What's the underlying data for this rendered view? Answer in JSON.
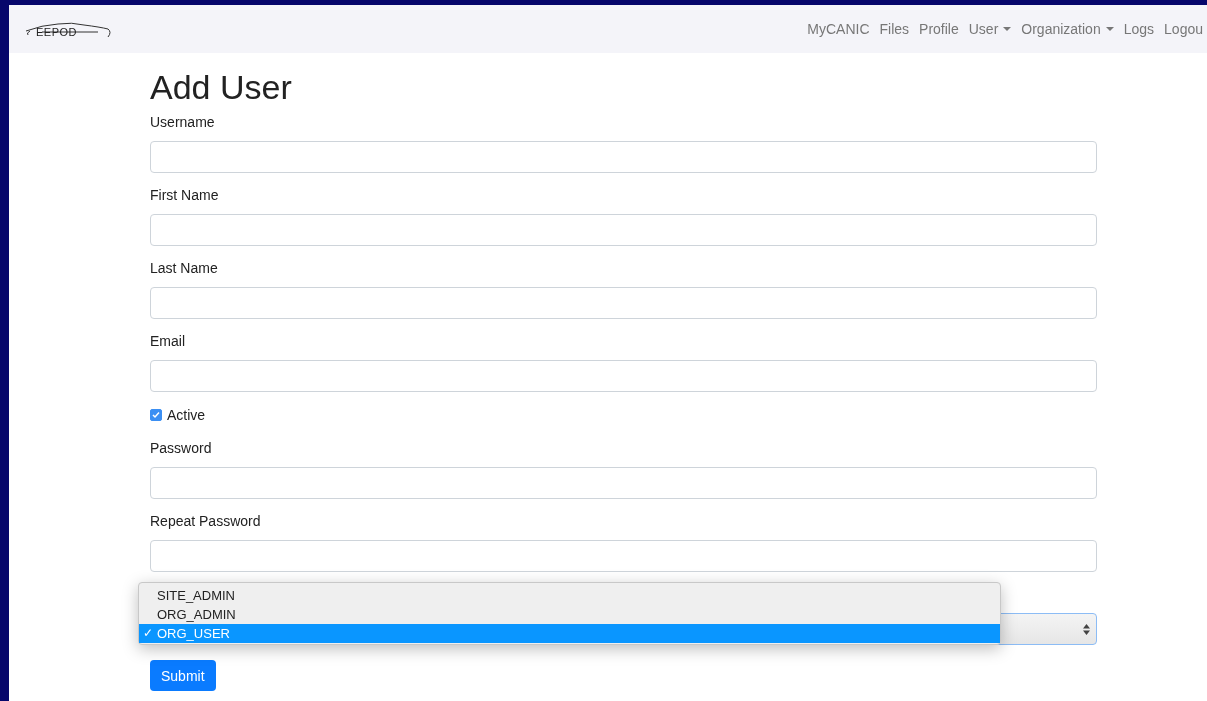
{
  "navbar": {
    "logo_text": "EEPOD",
    "links": [
      {
        "label": "MyCANIC",
        "dropdown": false
      },
      {
        "label": "Files",
        "dropdown": false
      },
      {
        "label": "Profile",
        "dropdown": false
      },
      {
        "label": "User",
        "dropdown": true
      },
      {
        "label": "Organization",
        "dropdown": true
      },
      {
        "label": "Logs",
        "dropdown": false
      },
      {
        "label": "Logou",
        "dropdown": false
      }
    ]
  },
  "title": "Add User",
  "fields": [
    {
      "kind": "text",
      "label": "Username"
    },
    {
      "kind": "text",
      "label": "First Name"
    },
    {
      "kind": "text",
      "label": "Last Name"
    },
    {
      "kind": "text",
      "label": "Email"
    },
    {
      "kind": "checkbox",
      "label": "Active",
      "checked": true
    },
    {
      "kind": "text",
      "label": "Password"
    },
    {
      "kind": "text",
      "label": "Repeat Password"
    },
    {
      "kind": "select",
      "options": [
        {
          "label": "SITE_ADMIN",
          "selected": false
        },
        {
          "label": "ORG_ADMIN",
          "selected": false
        },
        {
          "label": "ORG_USER",
          "selected": true
        }
      ]
    }
  ],
  "check_mark": "✓",
  "submit": "Submit"
}
